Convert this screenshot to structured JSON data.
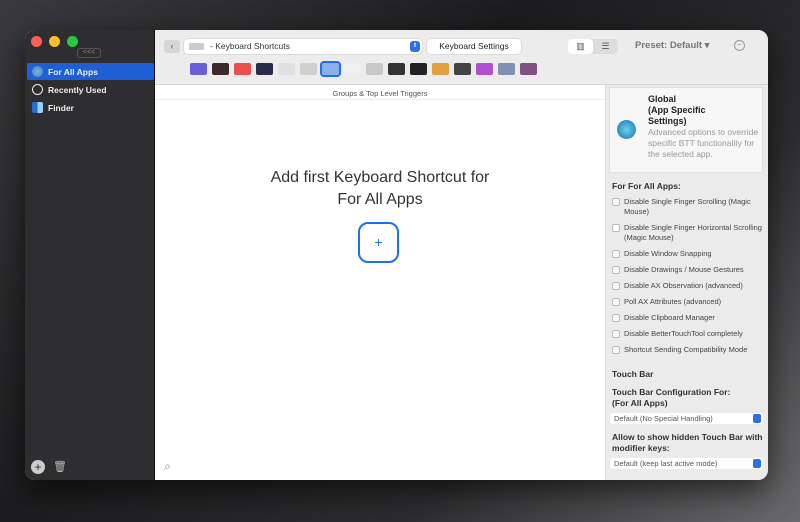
{
  "sidebar": {
    "collapse_label": "<<<",
    "items": [
      {
        "label": "For All Apps"
      },
      {
        "label": "Recently Used"
      },
      {
        "label": "Finder"
      }
    ],
    "add_label": "+",
    "delete_label": "🗑"
  },
  "toolbar": {
    "back_label": "‹",
    "trigger_type": "- Keyboard Shortcuts",
    "keyboard_settings_label": "Keyboard Settings",
    "preset_label": "Preset: Default ▾",
    "view_columns": "▥",
    "view_list": "☰",
    "minus": "−"
  },
  "trigger_icons": [
    "#6a5fd8",
    "#3a2a2a",
    "#e85050",
    "#2a2a4a",
    "#e0e0e0",
    "#cfcfcf",
    "keyboard",
    "#f0f0f0",
    "#c8c8c8",
    "#333",
    "#222",
    "#e0a040",
    "#444",
    "#b050d0",
    "#8090b0",
    "#805080"
  ],
  "main": {
    "groups_header": "Groups & Top Level Triggers",
    "empty_line1": "Add first Keyboard Shortcut for",
    "empty_line2": "For All Apps",
    "add_label": "+",
    "search_icon": "⌕"
  },
  "right": {
    "card_title": "Global\n(App Specific\nSettings)",
    "card_desc": "Advanced options to override specific BTT functionality for the selected app.",
    "section": "For For All Apps:",
    "checkboxes": [
      "Disable Single Finger Scrolling (Magic Mouse)",
      "Disable Single Finger Horizontal Scrolling (Magic Mouse)",
      "Disable Window Snapping",
      "Disable Drawings / Mouse Gestures",
      "Disable AX Observation (advanced)",
      "Poll AX Attributes (advanced)",
      "Disable Clipboard Manager",
      "Disable BetterTouchTool completely",
      "Shortcut Sending Compatibility Mode"
    ],
    "touchbar_header": "Touch Bar",
    "tb_config_label": "Touch Bar Configuration For:\n(For All Apps)",
    "tb_config_value": "Default (No Special Handling)",
    "hidden_label": "Allow to show hidden Touch Bar with modifier keys:",
    "hidden_value": "Default (keep last active mode)"
  }
}
